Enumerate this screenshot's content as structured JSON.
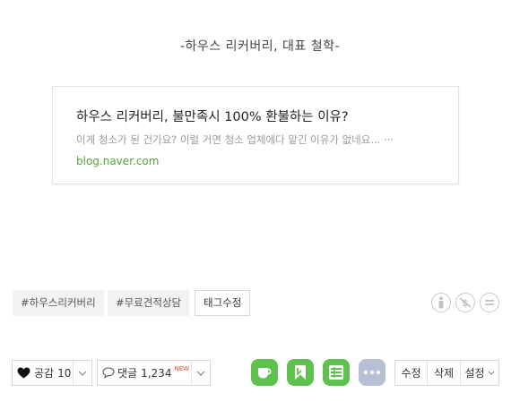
{
  "post": {
    "quote": "-하우스 리커버리, 대표 철학-"
  },
  "link_card": {
    "title": "하우스 리커버리, 불만족시 100% 환불하는 이유?",
    "description": "이게 청소가 된 건가요? 이럴 거면 청소 업체에다 맡긴 이유가 없네요... ···",
    "url": "blog.naver.com"
  },
  "tags": {
    "items": [
      "#하우스리커버리",
      "#무료견적상담"
    ],
    "edit_label": "태그수정"
  },
  "footer": {
    "like_label": "공감",
    "like_count": "10",
    "comment_label": "댓글",
    "comment_count": "1,234",
    "new_badge": "NEW",
    "edit_label": "수정",
    "delete_label": "삭제",
    "settings_label": "설정"
  },
  "colors": {
    "accent_green": "#5ec14e",
    "url_green": "#52a33c",
    "new_badge": "#e8442f",
    "more_button": "#b6bfd4"
  },
  "icons": {
    "license": [
      "info-circle-icon",
      "no-commercial-icon",
      "no-derivatives-icon"
    ],
    "share": [
      "coffee-cup-icon",
      "bookmark-icon",
      "list-icon",
      "more-icon"
    ]
  }
}
